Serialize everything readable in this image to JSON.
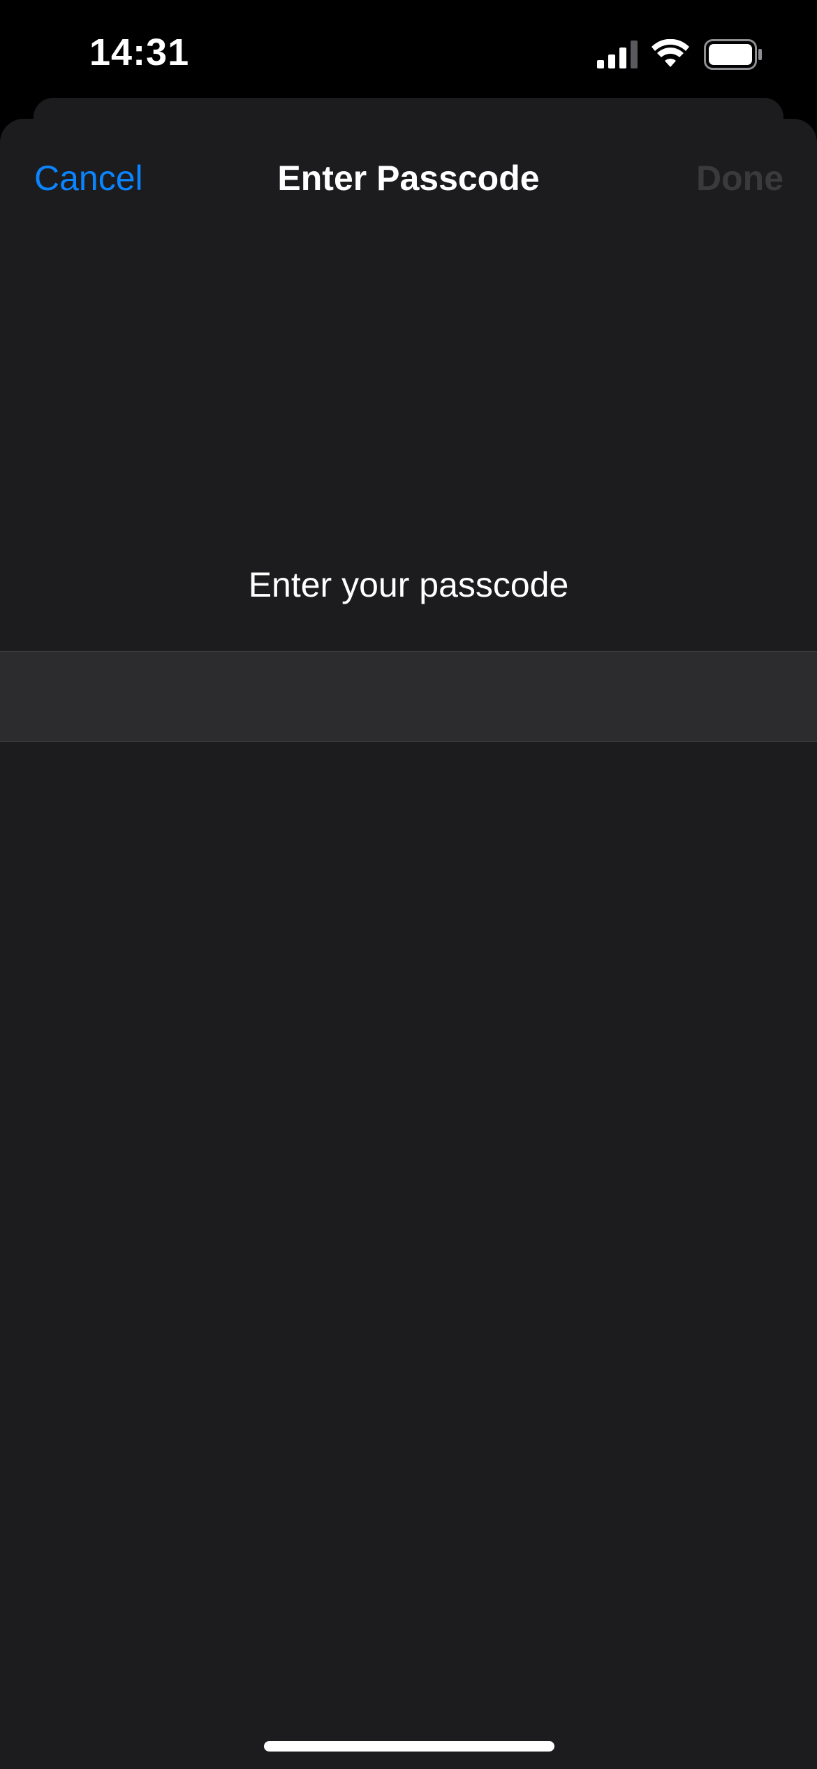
{
  "status_bar": {
    "time": "14:31",
    "icons": [
      "cellular-signal-icon",
      "wifi-icon",
      "battery-icon"
    ],
    "battery_level": 1.0
  },
  "nav": {
    "cancel_label": "Cancel",
    "title": "Enter Passcode",
    "done_label": "Done"
  },
  "main": {
    "prompt": "Enter your passcode",
    "passcode_value": "",
    "passcode_placeholder": ""
  },
  "colors": {
    "accent": "#0a84ff",
    "background": "#1c1c1e",
    "field_background": "#2c2c2e",
    "disabled_text": "#3a3a3c",
    "status_bar_background": "#000000"
  }
}
